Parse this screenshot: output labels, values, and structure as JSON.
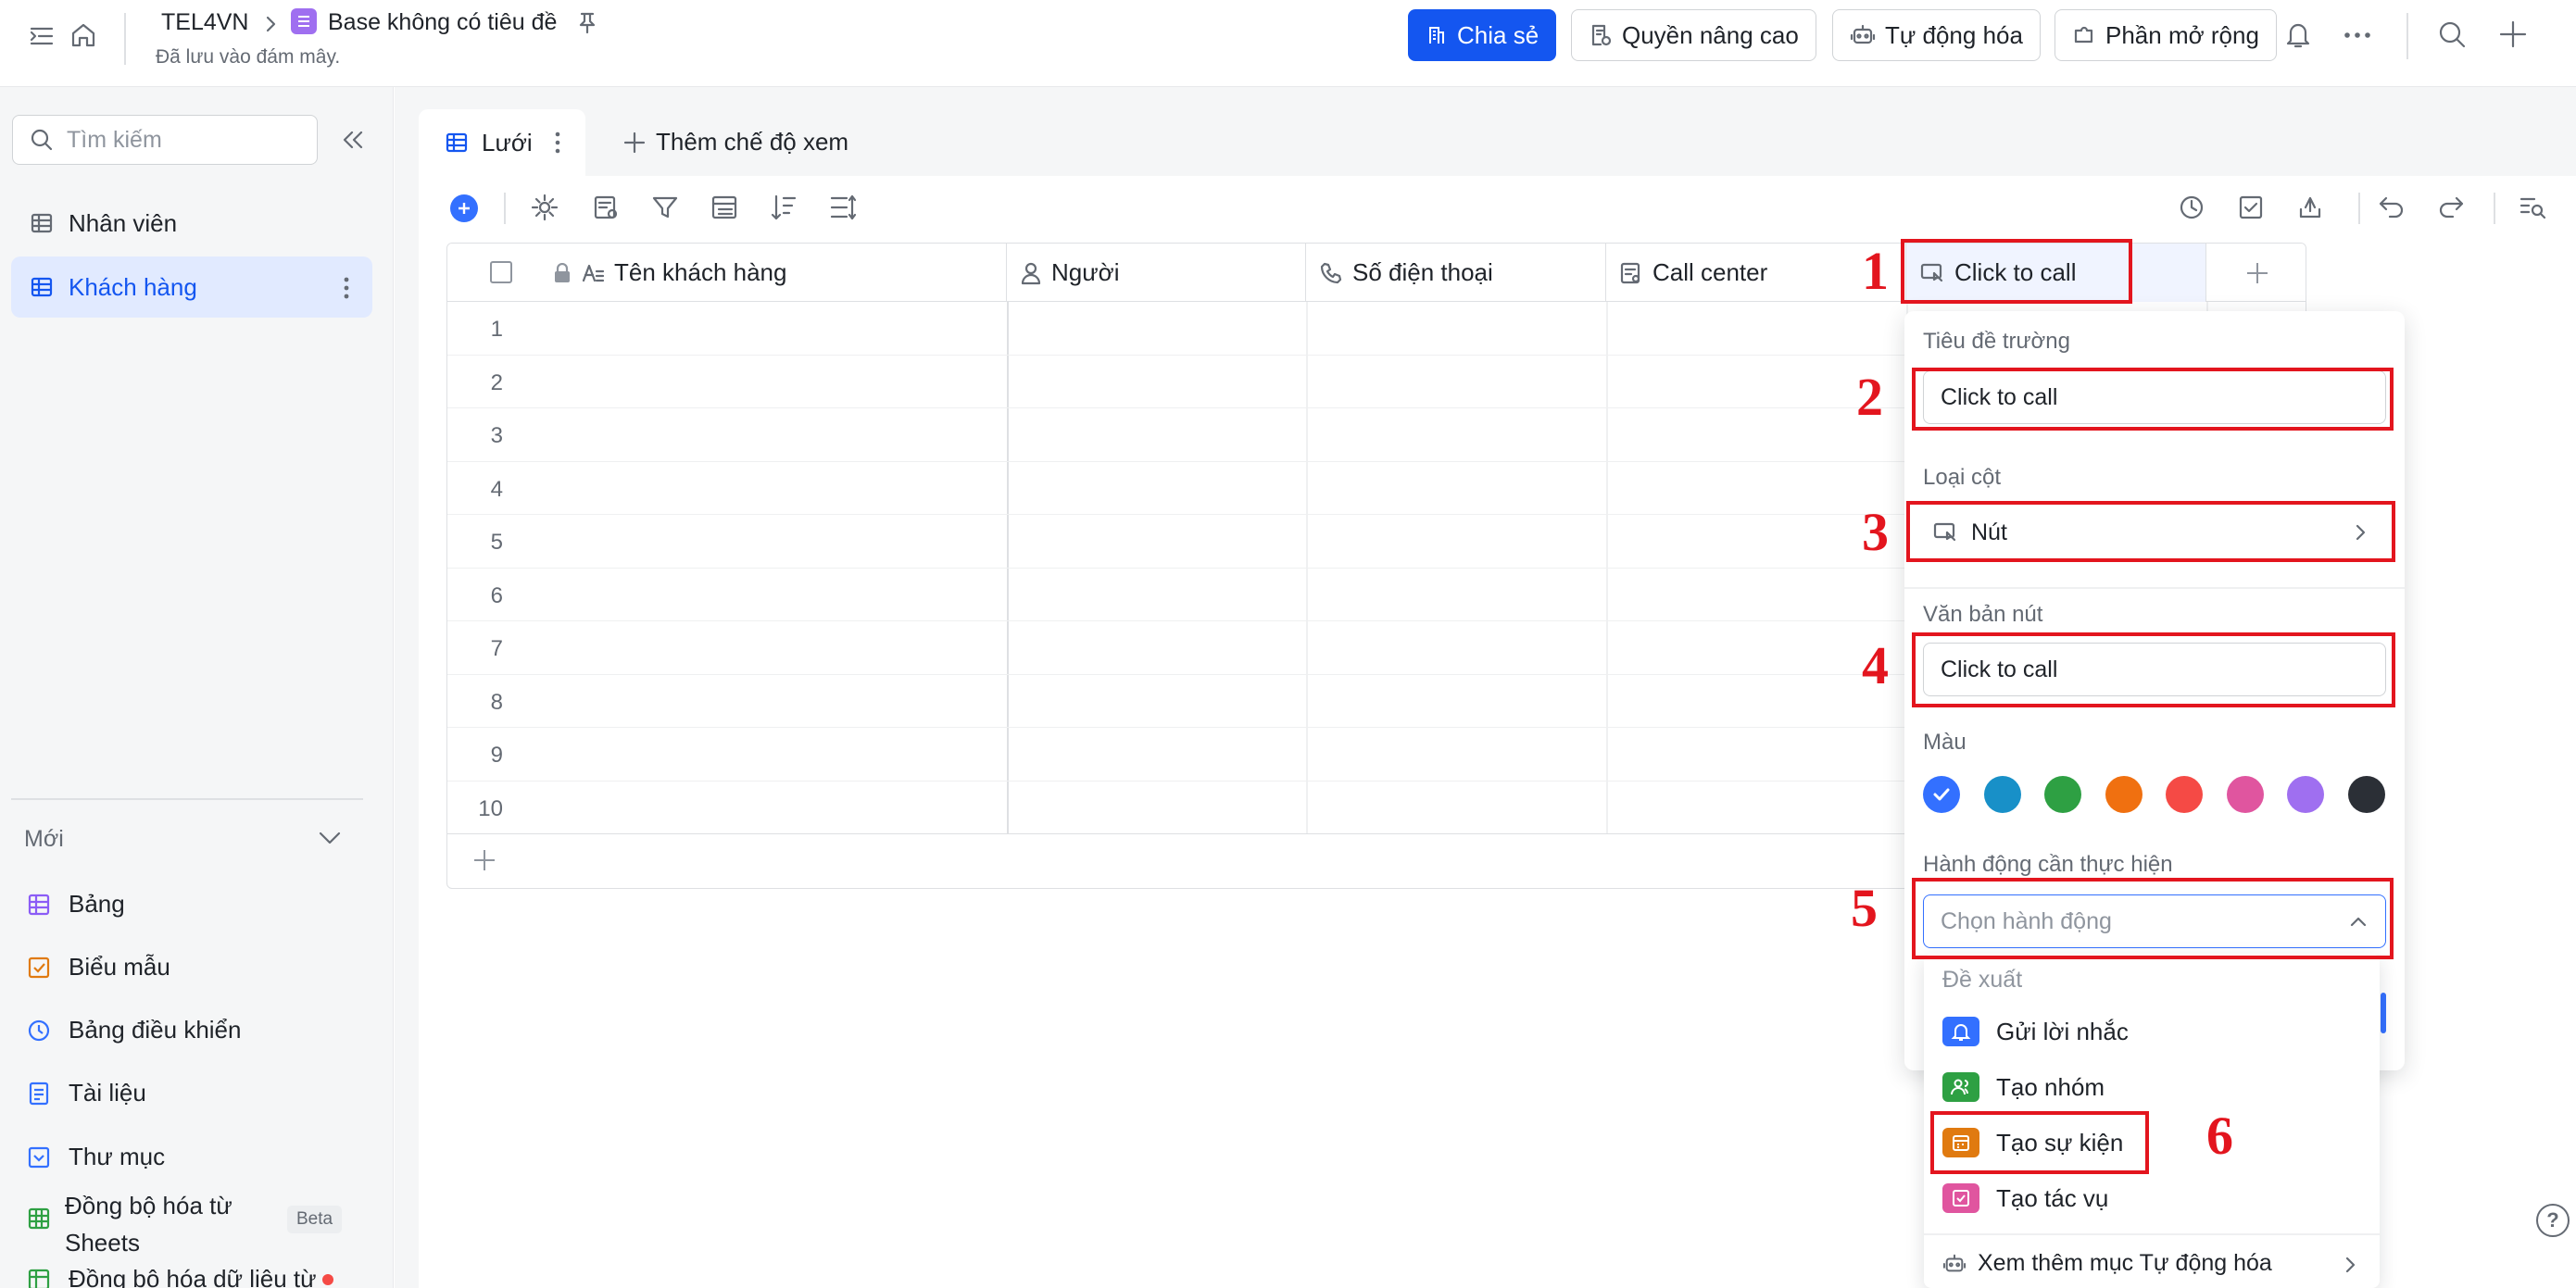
{
  "header": {
    "workspace": "TEL4VN",
    "base_title": "Base không có tiêu đề",
    "saved_status": "Đã lưu vào đám mây.",
    "share_label": "Chia sẻ",
    "advanced_permissions_label": "Quyền nâng cao",
    "automation_label": "Tự động hóa",
    "extensions_label": "Phần mở rộng"
  },
  "sidebar": {
    "search_placeholder": "Tìm kiếm",
    "tables": [
      {
        "label": "Nhân viên"
      },
      {
        "label": "Khách hàng"
      }
    ],
    "new_section_label": "Mới",
    "new_items": [
      {
        "label": "Bảng"
      },
      {
        "label": "Biểu mẫu"
      },
      {
        "label": "Bảng điều khiển"
      },
      {
        "label": "Tài liệu"
      },
      {
        "label": "Thư mục"
      },
      {
        "label": "Đồng bộ hóa từ Sheets",
        "line1": "Đồng bộ hóa từ",
        "line2": "Sheets",
        "badge": "Beta"
      },
      {
        "label": "Đồng bộ hóa dữ liệu từ"
      }
    ]
  },
  "views": {
    "active_view": "Lưới",
    "add_view_label": "Thêm chế độ xem"
  },
  "grid": {
    "columns": [
      "Tên khách hàng",
      "Người",
      "Số điện thoại",
      "Call center",
      "Click to call"
    ],
    "row_numbers": [
      "1",
      "2",
      "3",
      "4",
      "5",
      "6",
      "7",
      "8",
      "9",
      "10"
    ]
  },
  "field_panel": {
    "field_title_label": "Tiêu đề trường",
    "field_title_value": "Click to call",
    "column_type_label": "Loại cột",
    "column_type_value": "Nút",
    "button_text_label": "Văn bản nút",
    "button_text_value": "Click to call",
    "color_label": "Màu",
    "colors": [
      "#3370ff",
      "#1890c8",
      "#2ea043",
      "#f07010",
      "#f54a45",
      "#e0559f",
      "#9f6ff0",
      "#2b2f36"
    ],
    "selected_color": "#3370ff",
    "action_label": "Hành động cần thực hiện",
    "action_placeholder": "Chọn hành động",
    "suggest_label": "Đề xuất",
    "actions": [
      {
        "label": "Gửi lời nhắc",
        "color": "#3370ff"
      },
      {
        "label": "Tạo nhóm",
        "color": "#2ea043"
      },
      {
        "label": "Tạo sự kiện",
        "color": "#e07a10"
      },
      {
        "label": "Tạo tác vụ",
        "color": "#e0559f"
      }
    ],
    "more_automation_label": "Xem thêm mục Tự động hóa"
  },
  "annotations": [
    "1",
    "2",
    "3",
    "4",
    "5",
    "6"
  ]
}
